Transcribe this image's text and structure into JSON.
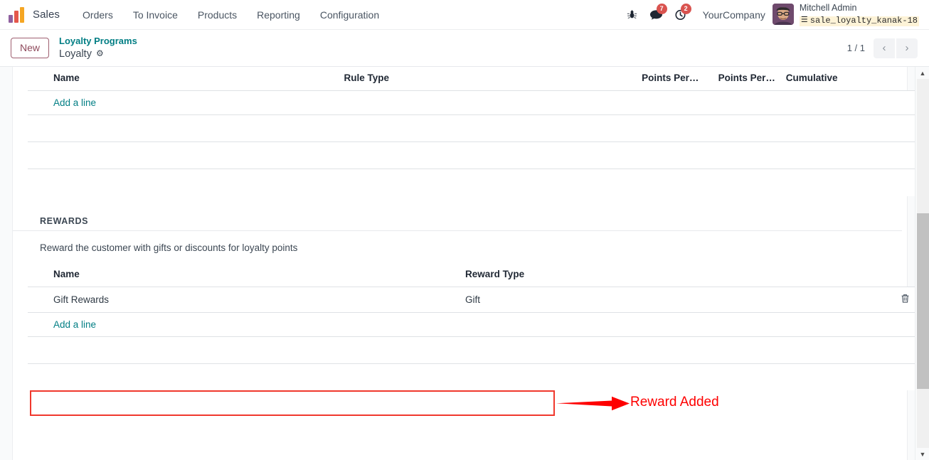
{
  "navbar": {
    "brand": "Sales",
    "logo_icon": "odoo-logo-icon",
    "menu": [
      {
        "label": "Orders"
      },
      {
        "label": "To Invoice"
      },
      {
        "label": "Products"
      },
      {
        "label": "Reporting"
      },
      {
        "label": "Configuration"
      }
    ],
    "icons": {
      "debug": "bug-icon",
      "messages": "chat-bubble-icon",
      "activities": "clock-icon",
      "database": "database-icon"
    },
    "messages_count": "7",
    "activities_count": "2",
    "company": "YourCompany",
    "user_name": "Mitchell Admin",
    "user_db": "sale_loyalty_kanak-18"
  },
  "control_panel": {
    "new_label": "New",
    "breadcrumb_parent": "Loyalty Programs",
    "breadcrumb_current": "Loyalty",
    "gear_icon": "gear-icon",
    "pager_count": "1 / 1",
    "prev_icon": "chevron-left-icon",
    "next_icon": "chevron-right-icon"
  },
  "rules_table": {
    "headers": {
      "name": "Name",
      "rule_type": "Rule Type",
      "points_per_1": "Points Per…",
      "points_per_2": "Points Per…",
      "cumulative": "Cumulative"
    },
    "add_line": "Add a line",
    "rows": []
  },
  "rewards": {
    "section_title": "REWARDS",
    "description": "Reward the customer with gifts or discounts for loyalty points",
    "headers": {
      "name": "Name",
      "reward_type": "Reward Type"
    },
    "rows": [
      {
        "name": "Gift Rewards",
        "reward_type": "Gift",
        "trash_icon": "trash-icon"
      }
    ],
    "add_line": "Add a line"
  },
  "annotation": {
    "text": "Reward Added",
    "color": "#fe0000"
  },
  "colors": {
    "accent_teal": "#017e84",
    "highlight_red": "#f0382d",
    "badge_red": "#d9534f",
    "sheet_bg": "#ffffff",
    "page_bg": "#f9fafb"
  },
  "scrollbar": {
    "up_icon": "caret-up-icon",
    "down_icon": "caret-down-icon"
  }
}
